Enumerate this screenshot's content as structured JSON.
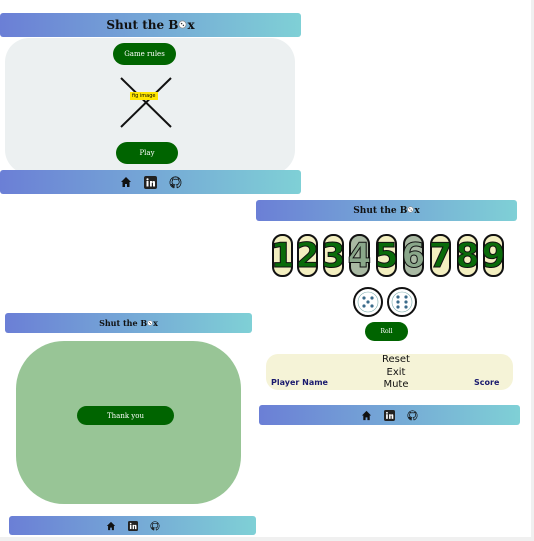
{
  "app": {
    "title": "Shut the Box",
    "title_prefix": "Shut the B",
    "title_suffix": "x"
  },
  "home": {
    "rules_label": "Game rules",
    "image_alt": "fig image",
    "play_label": "Play"
  },
  "game": {
    "tiles": [
      {
        "value": "1",
        "shut": false
      },
      {
        "value": "2",
        "shut": false
      },
      {
        "value": "3",
        "shut": false
      },
      {
        "value": "4",
        "shut": true
      },
      {
        "value": "5",
        "shut": false
      },
      {
        "value": "6",
        "shut": true
      },
      {
        "value": "7",
        "shut": false
      },
      {
        "value": "8",
        "shut": false
      },
      {
        "value": "9",
        "shut": false
      }
    ],
    "roll_label": "Roll",
    "menu": {
      "reset": "Reset",
      "exit": "Exit",
      "mute": "Mute"
    },
    "player_label": "Player Name",
    "score_label": "Score"
  },
  "end": {
    "thanks_label": "Thank you"
  },
  "footer": {
    "icons": [
      "home-icon",
      "linkedin-icon",
      "github-icon"
    ]
  },
  "colors": {
    "accent": "#006400",
    "header_start": "#6b7fd6",
    "header_end": "#7fd0d6",
    "card": "#ecf0f1",
    "end_card": "#98c596",
    "score_bg": "#f5f3d7"
  }
}
